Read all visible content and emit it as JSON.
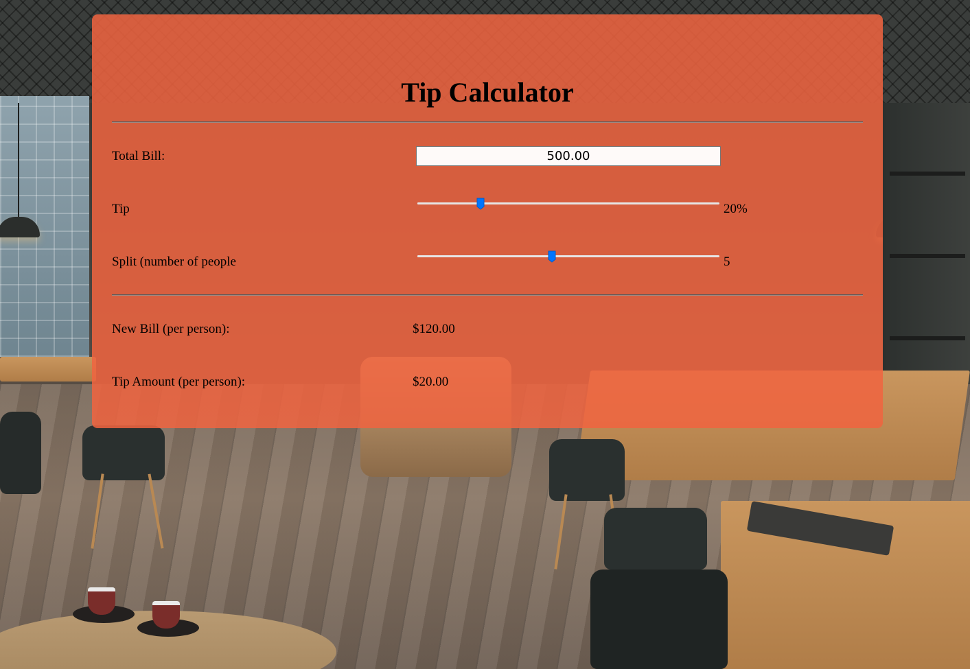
{
  "page": {
    "title": "Tip Calculator"
  },
  "form": {
    "bill_label": "Total Bill:",
    "bill_value": "500.00",
    "tip_label": "Tip",
    "tip_percent": 20,
    "tip_display": "20%",
    "tip_range": [
      0,
      100
    ],
    "split_label": "Split (number of people",
    "split_value": 5,
    "split_display": "5",
    "split_range": [
      1,
      10
    ]
  },
  "results": {
    "new_bill_label": "New Bill (per person):",
    "new_bill_value": "$120.00",
    "tip_amount_label": "Tip Amount (per person):",
    "tip_amount_value": "$20.00"
  },
  "colors": {
    "card_background": "#f06440",
    "slider_accent": "#0075ff"
  },
  "icons": {
    "slider_thumb": "slider-thumb-icon"
  }
}
